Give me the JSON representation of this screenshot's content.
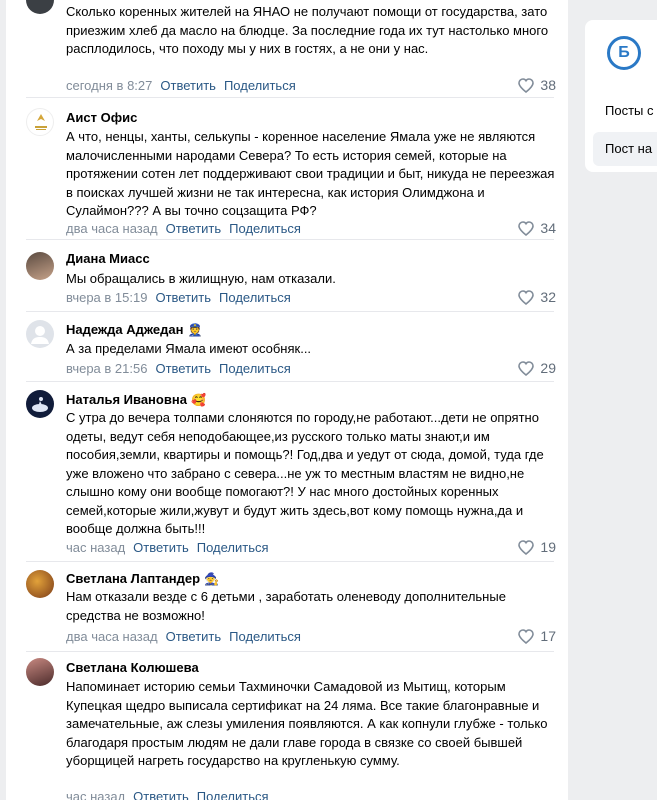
{
  "comments": [
    {
      "name": "",
      "text": "Сколько коренных жителей на ЯНАО не получают помощи от государства, зато приезжим хлеб да масло на блюдце. За последние года их тут настолько много расплодилось, что походу мы у них в гостях, а не они у нас.",
      "time": "сегодня в 8:27",
      "reply": "Ответить",
      "share": "Поделиться",
      "likes": "38"
    },
    {
      "name": "Аист Офис",
      "text": "А что, ненцы, ханты, селькупы - коренное население Ямала уже не являются малочисленными народами Севера? То есть история семей, которые на протяжении сотен лет поддерживают свои традиции и быт, никуда не переезжая в поисках лучшей жизни не так интересна, как история Олимджона и Сулаймон??? А вы точно соцзащита РФ?",
      "time": "два часа назад",
      "reply": "Ответить",
      "share": "Поделиться",
      "likes": "34"
    },
    {
      "name": "Диана Миасс",
      "text": "Мы обращались в жилищную, нам отказали.",
      "time": "вчера в 15:19",
      "reply": "Ответить",
      "share": "Поделиться",
      "likes": "32"
    },
    {
      "name": "Надежда Аджедан",
      "emoji": "👮",
      "text": "А за пределами Ямала имеют особняк...",
      "time": "вчера в 21:56",
      "reply": "Ответить",
      "share": "Поделиться",
      "likes": "29"
    },
    {
      "name": "Наталья Ивановна",
      "emoji": "🥰",
      "text": "С утра до вечера толпами слоняются по городу,не работают...дети не опрятно одеты, ведут себя неподобающее,из русского только маты знают,и им пособия,земли, квартиры и помощь?! Год,два и уедут от сюда, домой, туда где уже вложено что забрано с севера...не уж то местным властям не видно,не слышно кому они вообще помогают?! У нас много достойных коренных семей,которые жили,жувут и будут жить здесь,вот кому помощь нужна,да и вообще должна быть!!!",
      "time": "час назад",
      "reply": "Ответить",
      "share": "Поделиться",
      "likes": "19"
    },
    {
      "name": "Светлана Лаптандер",
      "emoji": "🧙",
      "text": "Нам отказали везде с 6 детьми , заработать оленеводу дополнительные средства не возможно!",
      "time": "два часа назад",
      "reply": "Ответить",
      "share": "Поделиться",
      "likes": "17"
    },
    {
      "name": "Светлана Колюшева",
      "text": "Напоминает историю семьи Тахминочки Самадовой из Мытищ, которым Купецкая щедро выписала сертификат на 24 ляма. Все такие благонравные и замечательные, аж слезы умиления появляются. А как копнули глубже - только благодаря простым людям не дали главе города в связке со своей бывшей уборщицей нагреть государство на кругленькую сумму.",
      "time": "час назад",
      "reply": "Ответить",
      "share": "Поделиться",
      "likes": ""
    }
  ],
  "sidebar": {
    "logo": "Б",
    "items": [
      "Посты с",
      "Пост на"
    ]
  },
  "colors": {
    "link": "#2a5885",
    "meta": "#818c99",
    "accent": "#2a79c6"
  }
}
